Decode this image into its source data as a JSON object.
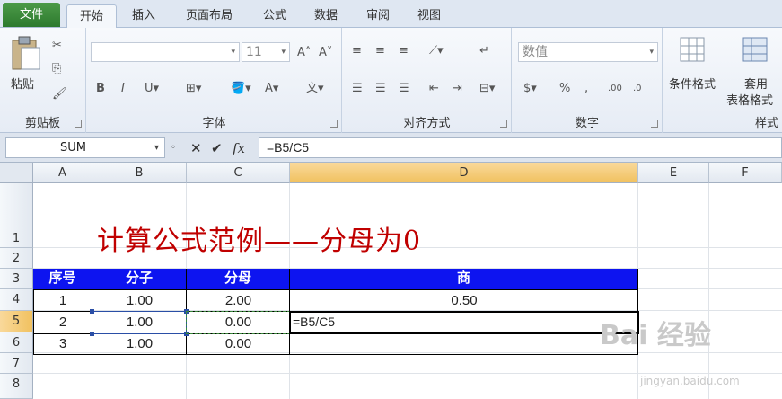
{
  "tabs": [
    "文件",
    "开始",
    "插入",
    "页面布局",
    "公式",
    "数据",
    "审阅",
    "视图"
  ],
  "ribbon": {
    "clipboard": {
      "paste_label": "粘贴",
      "group_label": "剪贴板"
    },
    "font": {
      "size_value": "11",
      "group_label": "字体"
    },
    "alignment": {
      "group_label": "对齐方式"
    },
    "number": {
      "format_value": "数值",
      "group_label": "数字"
    },
    "styles": {
      "conditional_label": "条件格式",
      "table_label_1": "套用",
      "table_label_2": "表格格式",
      "group_label": "样式"
    }
  },
  "formula_bar": {
    "name_box": "SUM",
    "formula": "=B5/C5"
  },
  "columns": [
    "A",
    "B",
    "C",
    "D",
    "E",
    "F"
  ],
  "rows": [
    "1",
    "2",
    "3",
    "4",
    "5",
    "6",
    "7",
    "8"
  ],
  "sheet": {
    "title": "计算公式范例——分母为0",
    "headers": [
      "序号",
      "分子",
      "分母",
      "商"
    ],
    "data": [
      [
        "1",
        "1.00",
        "2.00",
        "0.50"
      ],
      [
        "2",
        "1.00",
        "0.00",
        "=B5/C5"
      ],
      [
        "3",
        "1.00",
        "0.00",
        ""
      ]
    ]
  },
  "watermark": {
    "main": "Bai 经验",
    "sub": "jingyan.baidu.com"
  },
  "colors": {
    "header_fill": "#0d14f0",
    "title_color": "#c00000",
    "file_tab": "#2d7a2e",
    "selection_header": "#f1c15f"
  }
}
